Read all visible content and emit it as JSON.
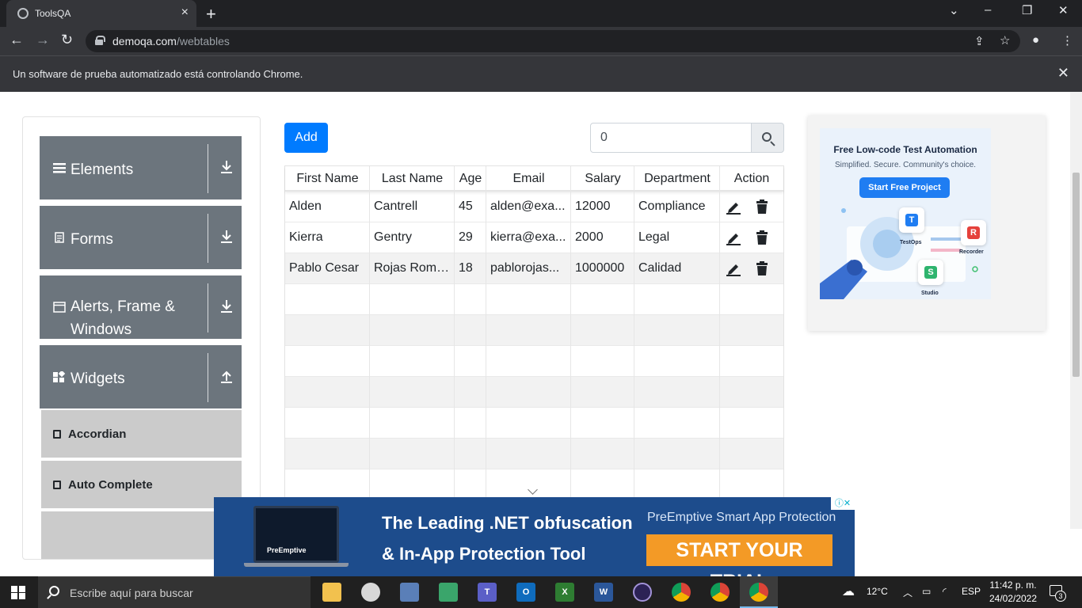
{
  "browser": {
    "tab_title": "ToolsQA",
    "url_domain": "demoqa.com",
    "url_path": "/webtables",
    "infobar_message": "Un software de prueba automatizado está controlando Chrome."
  },
  "sidebar": {
    "groups": [
      {
        "label": "Elements",
        "icon": "hamburger-icon",
        "state": "collapsed"
      },
      {
        "label": "Forms",
        "icon": "document-icon",
        "state": "collapsed"
      },
      {
        "label": "Alerts, Frame & Windows",
        "icon": "window-icon",
        "state": "collapsed"
      },
      {
        "label": "Widgets",
        "icon": "widgets-icon",
        "state": "expanded"
      }
    ],
    "items": [
      {
        "label": "Accordian"
      },
      {
        "label": "Auto Complete"
      }
    ]
  },
  "toolbar": {
    "add_label": "Add",
    "search_value": "0"
  },
  "table": {
    "columns": [
      "First Name",
      "Last Name",
      "Age",
      "Email",
      "Salary",
      "Department",
      "Action"
    ],
    "rows": [
      {
        "first": "Alden",
        "last": "Cantrell",
        "age": "45",
        "email": "alden@exa...",
        "salary": "12000",
        "department": "Compliance"
      },
      {
        "first": "Kierra",
        "last": "Gentry",
        "age": "29",
        "email": "kierra@exa...",
        "salary": "2000",
        "department": "Legal"
      },
      {
        "first": "Pablo Cesar",
        "last": "Rojas Rome...",
        "age": "18",
        "email": "pablorojas...",
        "salary": "1000000",
        "department": "Calidad"
      }
    ]
  },
  "ad_right": {
    "title": "Free Low-code Test Automation",
    "subtitle": "Simplified. Secure. Community's choice.",
    "button": "Start Free Project",
    "products": [
      "TestOps",
      "Recorder",
      "Studio"
    ]
  },
  "ad_bottom": {
    "headline_1": "The Leading .NET obfuscation",
    "headline_2": "& In-App Protection Tool",
    "brand_line": "PreEmptive Smart App Protection",
    "cta": "START YOUR TRIAL",
    "logo_text": "PreEmptive"
  },
  "taskbar": {
    "search_placeholder": "Escribe aquí para buscar",
    "temperature": "12°C",
    "language": "ESP",
    "time": "11:42 p. m.",
    "date": "24/02/2022",
    "notification_count": "3"
  },
  "colors": {
    "primary": "#007bff",
    "sidebar_group": "#6c757d",
    "sidebar_item": "#cbcbcb",
    "ad_cta": "#f39a26"
  }
}
